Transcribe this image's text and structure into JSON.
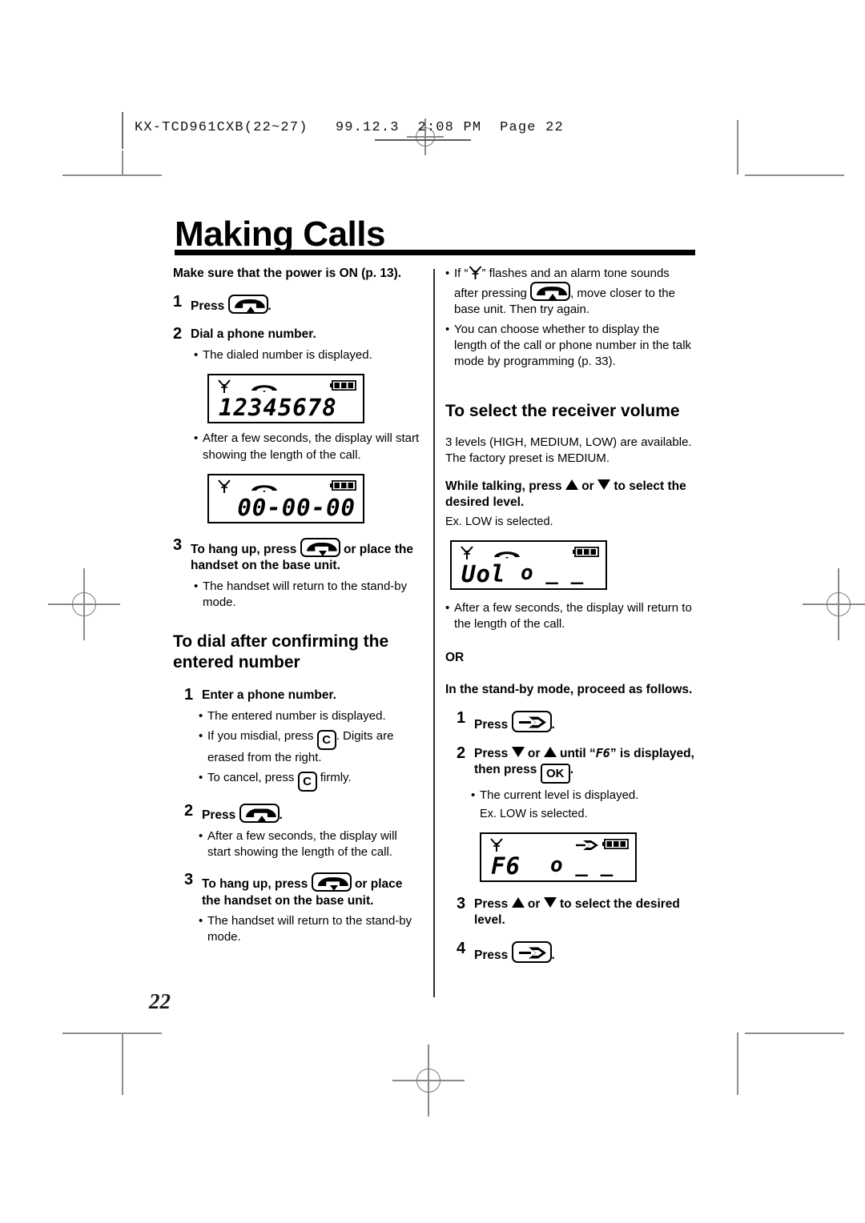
{
  "print_header": {
    "text": "KX-TCD961CXB(22~27)   99.12.3  2:08 PM  Page 22"
  },
  "page": {
    "title": "Making Calls",
    "page_number": "22"
  },
  "left_column": {
    "lead": "Make sure that the power is ON (p. 13).",
    "step1": {
      "num": "1",
      "pre": "Press",
      "post": "."
    },
    "step2": {
      "num": "2",
      "text": "Dial a phone number."
    },
    "step2_bullet": "The dialed number is displayed.",
    "lcd1": {
      "digits": "12345678"
    },
    "lcd1_bullet": "After a few seconds, the display will start showing the length of the call.",
    "lcd2": {
      "digits": "00-00-00"
    },
    "step3": {
      "num": "3",
      "pre": "To hang up, press",
      "post": "or place the handset on the base unit."
    },
    "step3_bullet": "The handset will return to the stand-by mode.",
    "subhead": "To dial after confirming the entered number",
    "b_step1": {
      "num": "1",
      "text": "Enter a phone number."
    },
    "b_bullet1": "The entered number is displayed.",
    "b_bullet2_pre": "If you misdial, press",
    "b_bullet2_key": "C",
    "b_bullet2_post": ". Digits are erased from the right.",
    "b_bullet3_pre": "To cancel, press",
    "b_bullet3_key": "C",
    "b_bullet3_post": "firmly.",
    "b_step2": {
      "num": "2",
      "pre": "Press",
      "post": "."
    },
    "b_step2_bullet": "After a few seconds, the display will start showing the length of the call.",
    "b_step3": {
      "num": "3",
      "pre": "To hang up, press",
      "post": "or place the handset on the base unit."
    },
    "b_step3_bullet": "The handset will return to the stand-by mode."
  },
  "right_column": {
    "bullet1_a": "If “",
    "bullet1_b": "” flashes and an alarm tone sounds after pressing",
    "bullet1_c": ", move closer to the base unit. Then try again.",
    "bullet2": "You can choose whether to display the length of the call or phone number in the talk mode by programming (p. 33).",
    "subhead": "To select the receiver volume",
    "intro": "3 levels (HIGH, MEDIUM, LOW) are available. The factory preset is MEDIUM.",
    "instruction_a": "While talking, press",
    "instruction_or": "or",
    "instruction_b": "to select the desired level.",
    "ex_note": "Ex. LOW is selected.",
    "lcd_vol": {
      "label": "Uol",
      "level": "o _ _"
    },
    "after_bullet": "After a few seconds, the display will return to the length of the call.",
    "or_label": "OR",
    "standby_lead": "In the stand-by mode, proceed as follows.",
    "s1": {
      "num": "1",
      "pre": "Press",
      "post": "."
    },
    "s2": {
      "num": "2",
      "pre": "Press",
      "mid_or": "or",
      "until": "until “",
      "code": "F6",
      "after": "” is displayed, then press",
      "post": "."
    },
    "s2_key": "OK",
    "s2_bullet": "The current level is displayed.",
    "s2_note": "Ex. LOW is selected.",
    "lcd_f6": {
      "label": "F6",
      "level": "o _ _"
    },
    "s3": {
      "num": "3",
      "pre": "Press",
      "mid_or": "or",
      "post": "to select the desired level."
    },
    "s4": {
      "num": "4",
      "pre": "Press",
      "post": "."
    }
  }
}
